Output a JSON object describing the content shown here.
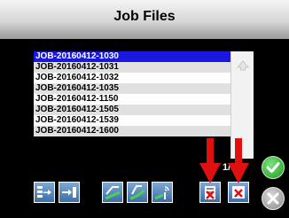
{
  "header": {
    "title": "Job Files"
  },
  "jobs": [
    "JOB-20160412-1030",
    "JOB-20160412-1031",
    "JOB-20160412-1032",
    "JOB-20160412-1035",
    "JOB-20160412-1150",
    "JOB-20160412-1505",
    "JOB-20160412-1539",
    "JOB-20160412-1600"
  ],
  "selected_index": 0,
  "pagination": {
    "indicator": "1/3"
  },
  "toolbar": {
    "buttons": [
      {
        "icon": "import-files-icon"
      },
      {
        "icon": "export-file-icon"
      },
      {
        "icon": "field-ab-line-icon"
      },
      {
        "icon": "field-curve-icon"
      },
      {
        "icon": "field-signal-icon"
      },
      {
        "icon": "delete-file-icon"
      },
      {
        "icon": "delete-all-files-icon"
      }
    ]
  },
  "colors": {
    "selected_row": "#1818e0",
    "accept": "#1e9e1e",
    "cancel": "#8a8a8a",
    "annotation_arrow": "#e01010"
  }
}
